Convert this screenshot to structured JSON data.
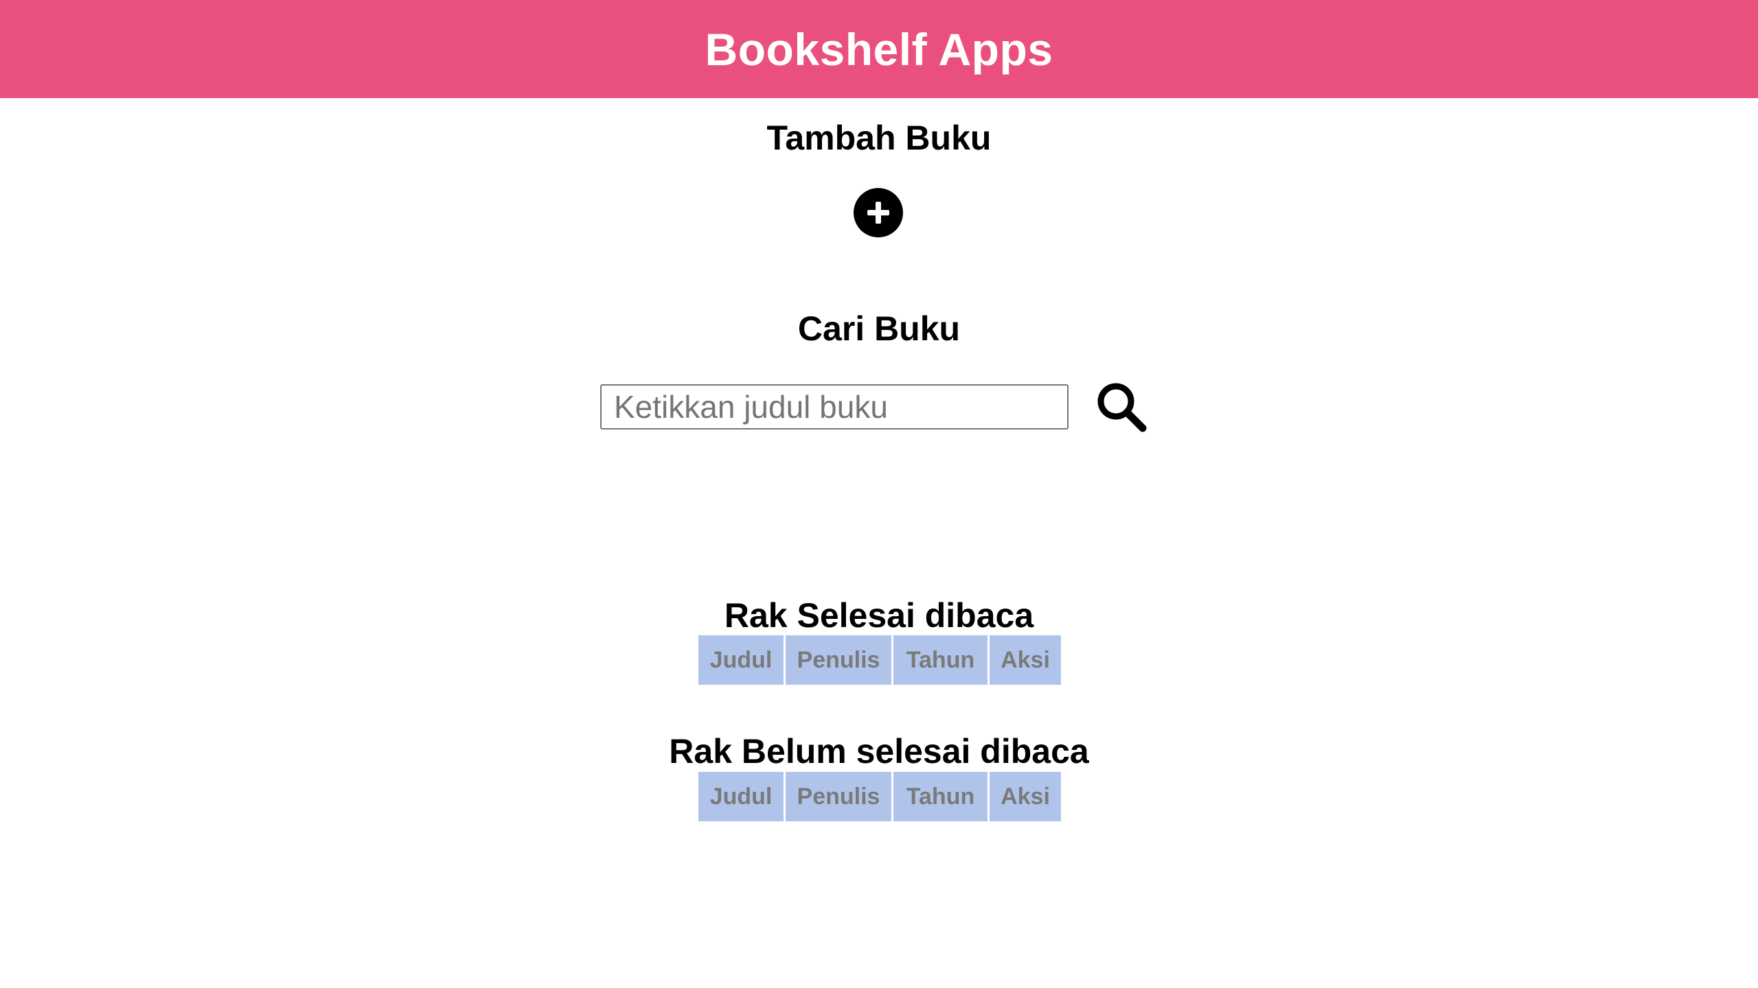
{
  "header": {
    "title": "Bookshelf Apps",
    "background": "#e9507e"
  },
  "add_section": {
    "title": "Tambah Buku",
    "add_icon": "plus-circle-icon"
  },
  "search_section": {
    "title": "Cari Buku",
    "input_value": "",
    "input_placeholder": "Ketikkan judul buku",
    "search_icon": "magnifier-icon"
  },
  "shelves": [
    {
      "title": "Rak Selesai dibaca",
      "columns": [
        "Judul",
        "Penulis",
        "Tahun",
        "Aksi"
      ],
      "rows": []
    },
    {
      "title": "Rak Belum selesai dibaca",
      "columns": [
        "Judul",
        "Penulis",
        "Tahun",
        "Aksi"
      ],
      "rows": []
    }
  ],
  "colors": {
    "table_header_bg": "#b0c4eb",
    "table_header_text": "#7a7a7a"
  }
}
